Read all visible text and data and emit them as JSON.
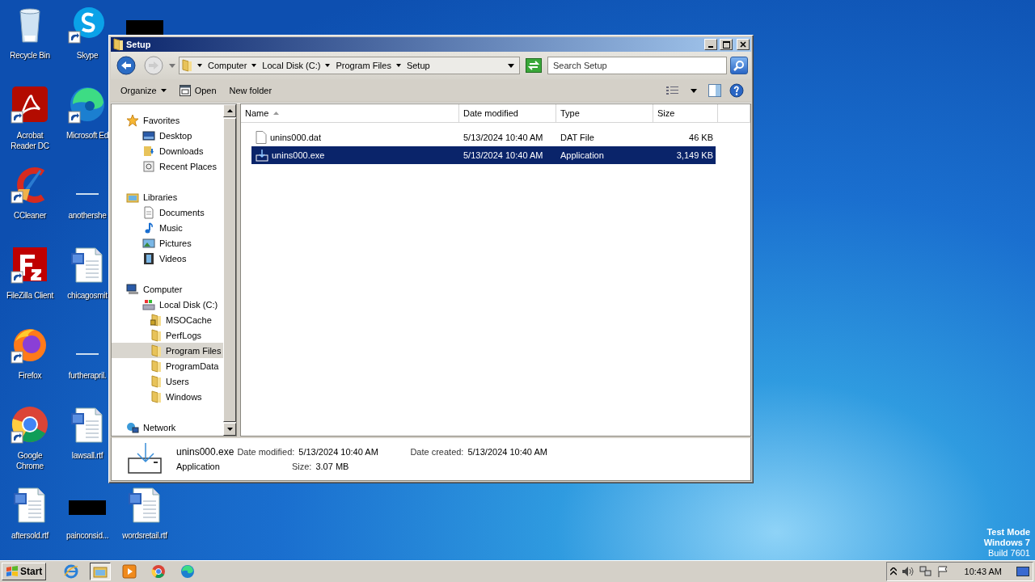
{
  "desktop": {
    "columns": [
      {
        "icons": [
          {
            "kind": "recycle",
            "label": "Recycle Bin",
            "shortcut": false
          },
          {
            "kind": "pdf",
            "label": "Acrobat Reader DC",
            "shortcut": true
          },
          {
            "kind": "cleaner",
            "label": "CCleaner",
            "shortcut": true
          },
          {
            "kind": "ftp",
            "label": "FileZilla Client",
            "shortcut": true
          },
          {
            "kind": "firefox",
            "label": "Firefox",
            "shortcut": true
          },
          {
            "kind": "chrome",
            "label": "Google Chrome",
            "shortcut": true
          },
          {
            "kind": "word",
            "label": "aftersold.rtf",
            "shortcut": false
          }
        ]
      },
      {
        "icons": [
          {
            "kind": "skype",
            "label": "Skype",
            "shortcut": true
          },
          {
            "kind": "edge",
            "label": "Microsoft Ed",
            "shortcut": true
          },
          {
            "kind": "blank",
            "label": "anothershe",
            "shortcut": false
          },
          {
            "kind": "word",
            "label": "chicagosmit",
            "shortcut": false
          },
          {
            "kind": "blank",
            "label": "furtherapril.",
            "shortcut": false
          },
          {
            "kind": "word",
            "label": "lawsall.rtf",
            "shortcut": false
          },
          {
            "kind": "dark",
            "label": "painconsid...",
            "shortcut": false
          }
        ]
      },
      {
        "icons": [
          {
            "kind": "dark",
            "shortcut": false
          },
          {
            "kind": "word",
            "label": "wordsretail.rtf",
            "shortcut": false
          }
        ]
      }
    ],
    "notice": [
      {
        "text": "Test Mode",
        "bold": true
      },
      {
        "text": "Windows 7",
        "bold": true
      },
      {
        "text": "Build 7601",
        "bold": false
      }
    ]
  },
  "window": {
    "title": "Setup",
    "address": {
      "crumbs": [
        "Computer",
        "Local Disk (C:)",
        "Program Files",
        "Setup"
      ]
    },
    "search": {
      "placeholder": "Search Setup"
    },
    "toolbar": [
      {
        "kind": "menu",
        "label": "Organize"
      },
      {
        "kind": "open",
        "label": "Open"
      },
      {
        "kind": "plain",
        "label": "New folder"
      }
    ],
    "nav": [
      {
        "kind": "star",
        "label": "Favorites",
        "selected": false,
        "children": [
          {
            "kind": "desktop",
            "label": "Desktop",
            "selected": false
          },
          {
            "kind": "download",
            "label": "Downloads",
            "selected": false
          },
          {
            "kind": "recent",
            "label": "Recent Places",
            "selected": false
          }
        ]
      },
      {
        "kind": "library",
        "label": "Libraries",
        "selected": false,
        "children": [
          {
            "kind": "document",
            "label": "Documents",
            "selected": false
          },
          {
            "kind": "music",
            "label": "Music",
            "selected": false
          },
          {
            "kind": "picture",
            "label": "Pictures",
            "selected": false
          },
          {
            "kind": "video",
            "label": "Videos",
            "selected": false
          }
        ]
      },
      {
        "kind": "computer",
        "label": "Computer",
        "selected": false,
        "children": [
          {
            "kind": "disk",
            "label": "Local Disk (C:)",
            "selected": false,
            "children": [
              {
                "kind": "locked",
                "label": "MSOCache",
                "selected": false
              },
              {
                "kind": "folder",
                "label": "PerfLogs",
                "selected": false
              },
              {
                "kind": "folder",
                "label": "Program Files",
                "selected": true
              },
              {
                "kind": "folder",
                "label": "ProgramData",
                "selected": false
              },
              {
                "kind": "folder",
                "label": "Users",
                "selected": false
              },
              {
                "kind": "folder",
                "label": "Windows",
                "selected": false
              }
            ]
          }
        ]
      },
      {
        "kind": "network",
        "label": "Network",
        "selected": false
      }
    ],
    "columns": [
      "Name",
      "Date modified",
      "Type",
      "Size"
    ],
    "rows": [
      {
        "kind": "file",
        "name": "unins000.dat",
        "date": "5/13/2024 10:40 AM",
        "type": "DAT File",
        "size": "46 KB",
        "selected": false
      },
      {
        "kind": "installer",
        "name": "unins000.exe",
        "date": "5/13/2024 10:40 AM",
        "type": "Application",
        "size": "3,149 KB",
        "selected": true
      }
    ],
    "details": {
      "name": "unins000.exe",
      "type": "Application",
      "fields": [
        {
          "label": "Date modified:",
          "value": "5/13/2024 10:40 AM"
        },
        {
          "label": "Date created:",
          "value": "5/13/2024 10:40 AM"
        },
        {
          "label": "Size:",
          "value": "3.07 MB"
        }
      ]
    }
  },
  "taskbar": {
    "start": "Start",
    "apps": [
      {
        "kind": "ie",
        "selected": false
      },
      {
        "kind": "explorer",
        "selected": true
      },
      {
        "kind": "media",
        "selected": false
      },
      {
        "kind": "chrome",
        "selected": false
      },
      {
        "kind": "edge",
        "selected": false
      }
    ],
    "clock": "10:43 AM"
  }
}
